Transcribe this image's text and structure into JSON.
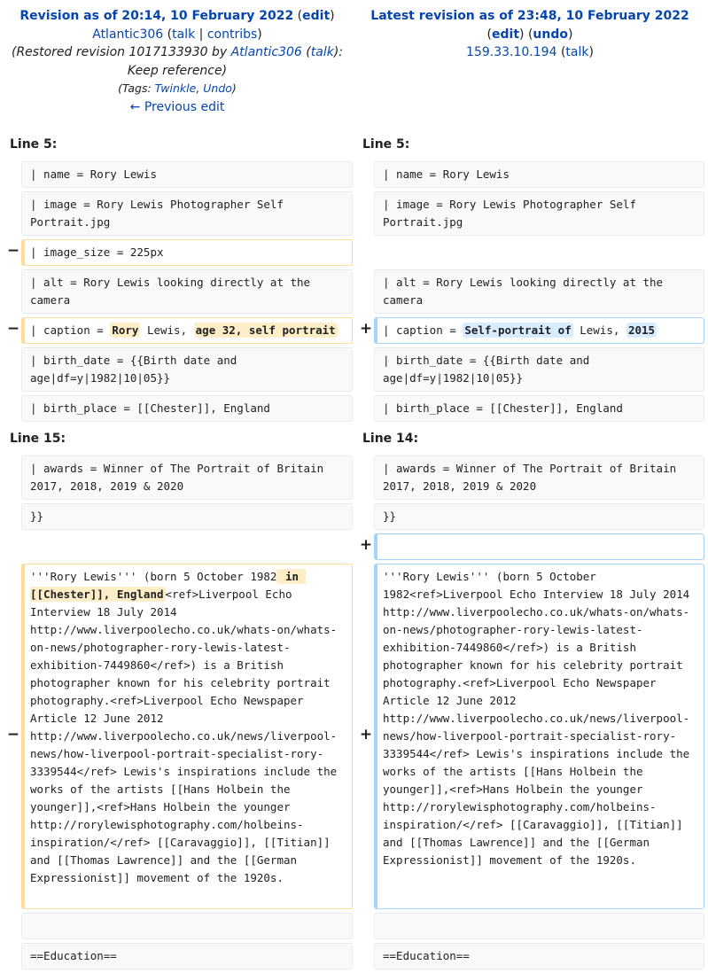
{
  "left_header": {
    "title": "Revision as of 20:14, 10 February 2022",
    "edit_label": "edit",
    "user": "Atlantic306",
    "talk": "talk",
    "sep": "|",
    "contribs": "contribs",
    "summary_prefix": "(Restored revision 1017133930 by ",
    "summary_user": "Atlantic306",
    "summary_talk": "talk",
    "summary_suffix": "): Keep reference)",
    "tags_prefix": "(Tags: ",
    "tag1": "Twinkle",
    "tag2": "Undo",
    "tags_suffix": ")",
    "prev_edit": "← Previous edit"
  },
  "right_header": {
    "title": "Latest revision as of 23:48, 10 February 2022",
    "edit_label": "edit",
    "undo_label": "undo",
    "ip": "159.33.10.194",
    "talk": "talk"
  },
  "line_numbers": {
    "left_1": "Line 5:",
    "right_1": "Line 5:",
    "left_2": "Line 15:",
    "right_2": "Line 14:"
  },
  "markers": {
    "minus": "−",
    "plus": "+"
  },
  "rows": {
    "name": "| name = Rory Lewis",
    "image": "| image = Rory Lewis Photographer Self Portrait.jpg",
    "image_size": "| image_size = 225px",
    "alt": "| alt = Rory Lewis looking directly at the camera",
    "caption_left": {
      "p1": "| caption = ",
      "c1": "Rory",
      "p2": " Lewis, ",
      "c2": "age 32, self portrait"
    },
    "caption_right": {
      "p1": "| caption = ",
      "c1": "Self-portrait of",
      "p2": " Lewis, ",
      "c2": "2015"
    },
    "birth_date": "| birth_date = {{Birth date and age|df=y|1982|10|05}}",
    "birth_place": "| birth_place = [[Chester]], England",
    "awards": "| awards = Winner of The Portrait of Britain 2017, 2018, 2019 & 2020",
    "close": "}}",
    "para_left": {
      "p1": "'''Rory Lewis''' (born 5 October 1982",
      "c1": " in [[Chester]], England",
      "p2": "<ref>Liverpool Echo Interview 18 July 2014 http://www.liverpoolecho.co.uk/whats-on/whats-on-news/photographer-rory-lewis-latest-exhibition-7449860</ref>) is a British photographer known for his celebrity portrait photography.<ref>Liverpool Echo Newspaper Article 12 June 2012 http://www.liverpoolecho.co.uk/news/liverpool-news/how-liverpool-portrait-specialist-rory-3339544</ref> Lewis's inspirations include the works of the artists [[Hans Holbein the younger]],<ref>Hans Holbein the younger http://rorylewisphotography.com/holbeins-inspiration/</ref> [[Caravaggio]], [[Titian]] and [[Thomas Lawrence]] and the [[German Expressionist]] movement of the 1920s."
    },
    "para_right": "'''Rory Lewis''' (born 5 October 1982<ref>Liverpool Echo Interview 18 July 2014 http://www.liverpoolecho.co.uk/whats-on/whats-on-news/photographer-rory-lewis-latest-exhibition-7449860</ref>) is a British photographer known for his celebrity portrait photography.<ref>Liverpool Echo Newspaper Article 12 June 2012 http://www.liverpoolecho.co.uk/news/liverpool-news/how-liverpool-portrait-specialist-rory-3339544</ref> Lewis's inspirations include the works of the artists [[Hans Holbein the younger]],<ref>Hans Holbein the younger http://rorylewisphotography.com/holbeins-inspiration/</ref> [[Caravaggio]], [[Titian]] and [[Thomas Lawrence]] and the [[German Expressionist]] movement of the 1920s.",
    "education": "==Education=="
  }
}
